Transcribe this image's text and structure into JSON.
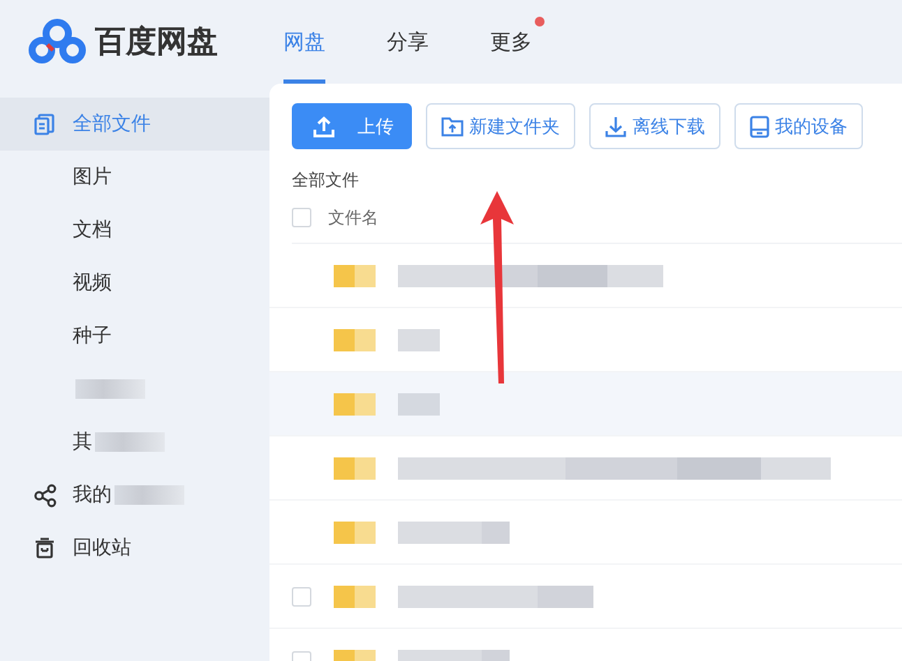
{
  "app": {
    "name": "百度网盘"
  },
  "nav_tabs": [
    {
      "label": "网盘",
      "selected": true,
      "badge": false
    },
    {
      "label": "分享",
      "selected": false,
      "badge": false
    },
    {
      "label": "更多",
      "selected": false,
      "badge": true
    }
  ],
  "sidebar": {
    "items": [
      {
        "label": "全部文件",
        "selected": true,
        "blurred": false
      },
      {
        "label": "图片",
        "selected": false,
        "blurred": false
      },
      {
        "label": "文档",
        "selected": false,
        "blurred": false
      },
      {
        "label": "视频",
        "selected": false,
        "blurred": false
      },
      {
        "label": "种子",
        "selected": false,
        "blurred": false
      },
      {
        "selected": false,
        "blurred": true
      },
      {
        "label": "其",
        "selected": false,
        "blurred": true
      },
      {
        "label": "我的",
        "selected": false,
        "blurred": true
      },
      {
        "label": "回收站",
        "selected": false,
        "blurred": false
      }
    ]
  },
  "toolbar": [
    {
      "label": "上传",
      "kind": "primary"
    },
    {
      "label": "新建文件夹",
      "kind": "outline"
    },
    {
      "label": "离线下载",
      "kind": "outline"
    },
    {
      "label": "我的设备",
      "kind": "outline"
    }
  ],
  "breadcrumb": "全部文件",
  "table": {
    "select_all": {
      "checked": false
    },
    "columns": [
      "文件名"
    ],
    "rows": [
      {
        "selected": false,
        "kind": "plain"
      },
      {
        "selected": false,
        "kind": "plain"
      },
      {
        "selected": true,
        "kind": "plain"
      },
      {
        "selected": false,
        "kind": "plain"
      },
      {
        "selected": false,
        "kind": "plain"
      },
      {
        "selected": false,
        "kind": "checkbox",
        "checked": false
      },
      {
        "selected": false,
        "kind": "checkbox",
        "checked": false
      }
    ]
  },
  "annotation": {
    "kind": "arrow"
  }
}
